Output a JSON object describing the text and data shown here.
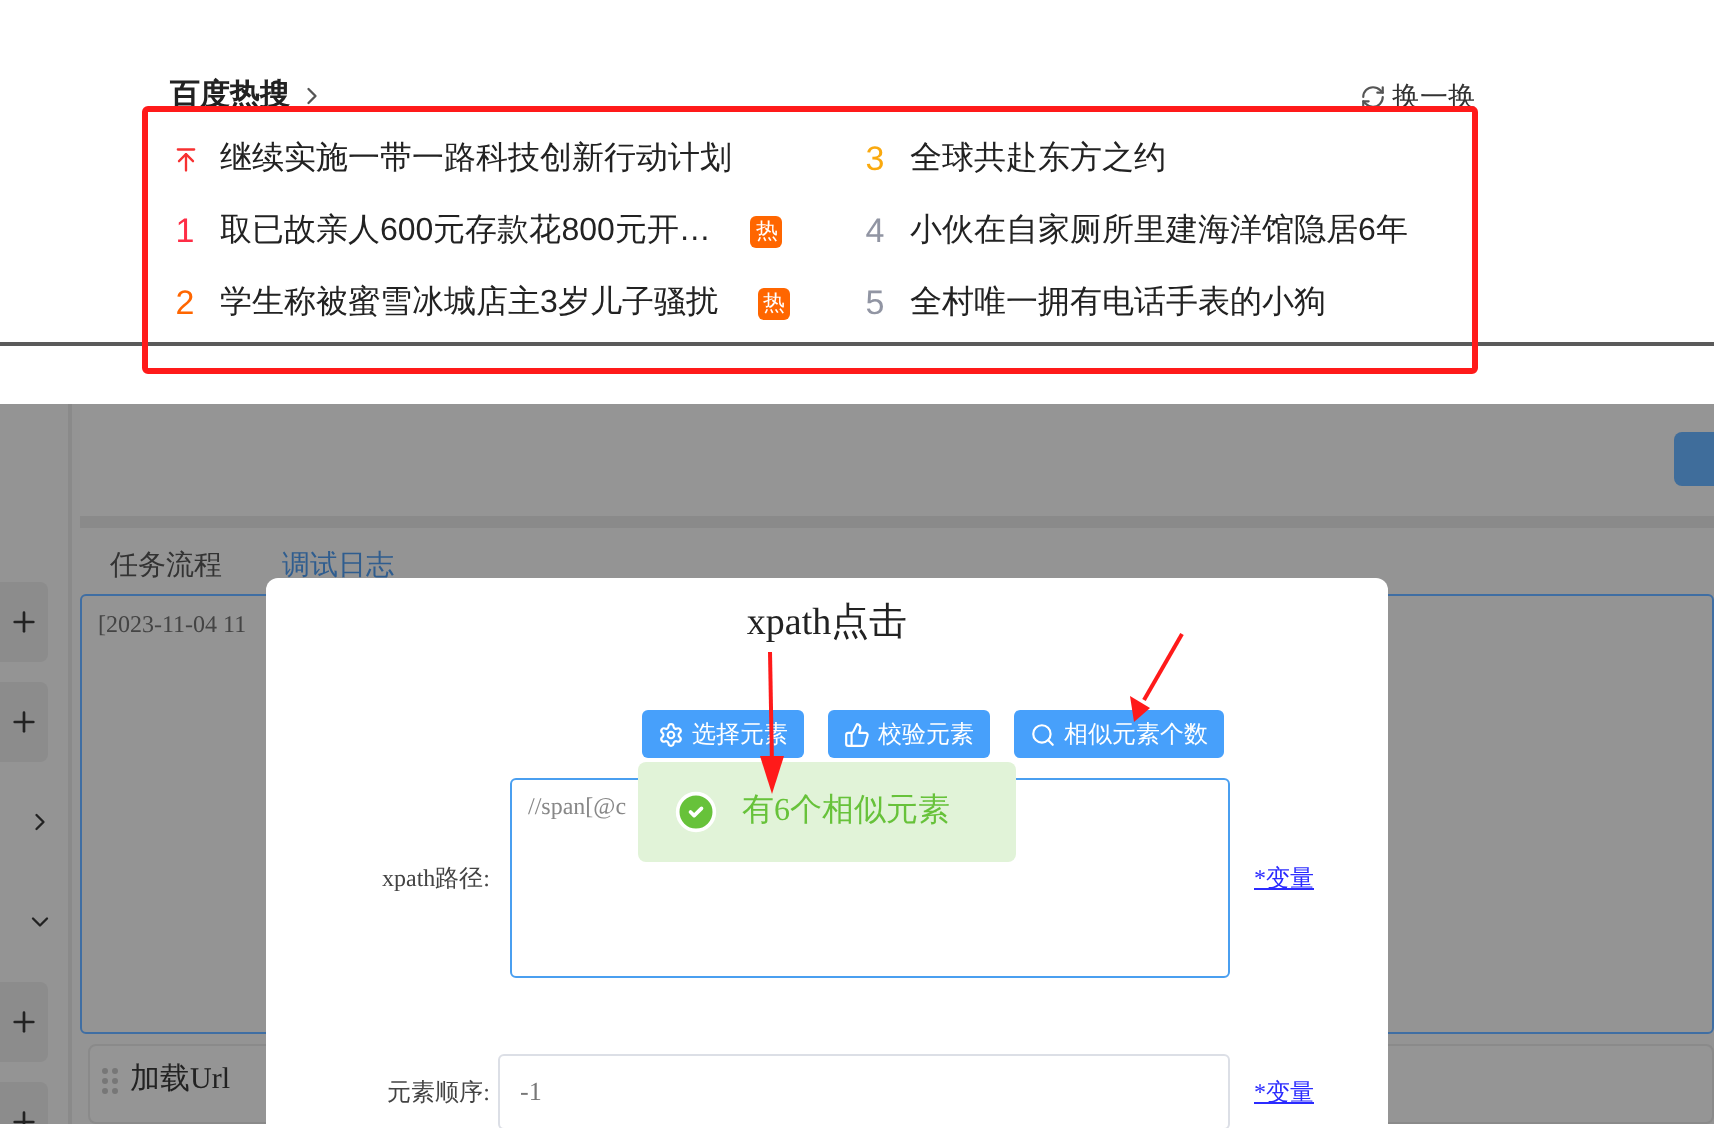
{
  "hot_search": {
    "title": "百度热搜",
    "refresh": "换一换",
    "items": [
      {
        "kind": "pinned",
        "title": "继续实施一带一路科技创新行动计划",
        "color": "#f73131"
      },
      {
        "kind": "ranked",
        "rank": "1",
        "title": "取已故亲人600元存款花800元开…",
        "badge": "热",
        "color": "#fe2d46"
      },
      {
        "kind": "ranked",
        "rank": "2",
        "title": "学生称被蜜雪冰城店主3岁儿子骚扰",
        "badge": "热",
        "color": "#ff6600"
      },
      {
        "kind": "ranked",
        "rank": "3",
        "title": "全球共赴东方之约",
        "color": "#faa90e"
      },
      {
        "kind": "ranked",
        "rank": "4",
        "title": "小伙在自家厕所里建海洋馆隐居6年",
        "color": "#9195a3"
      },
      {
        "kind": "ranked",
        "rank": "5",
        "title": "全村唯一拥有电话手表的小狗",
        "color": "#9195a3"
      }
    ]
  },
  "app": {
    "tabs": [
      {
        "label": "任务流程",
        "selected": false
      },
      {
        "label": "调试日志",
        "selected": true
      }
    ],
    "sidebar": [
      {
        "kind": "add"
      },
      {
        "kind": "add"
      },
      {
        "kind": "expand"
      },
      {
        "kind": "collapse"
      },
      {
        "kind": "add"
      },
      {
        "kind": "add"
      }
    ],
    "log_line": "[2023-11-04 11",
    "card_title": "加载Url"
  },
  "dialog": {
    "title": "xpath点击",
    "buttons": [
      {
        "kind": "select",
        "label": "选择元素"
      },
      {
        "kind": "check",
        "label": "校验元素"
      },
      {
        "kind": "search",
        "label": "相似元素个数"
      }
    ],
    "fields": [
      {
        "kind": "textarea",
        "label": "xpath路径:",
        "value": "//span[@c",
        "link": "*变量"
      },
      {
        "kind": "input",
        "label": "元素顺序:",
        "value": "-1",
        "link": "*变量"
      }
    ]
  },
  "toast": {
    "kind": "success",
    "message": "有6个相似元素"
  }
}
